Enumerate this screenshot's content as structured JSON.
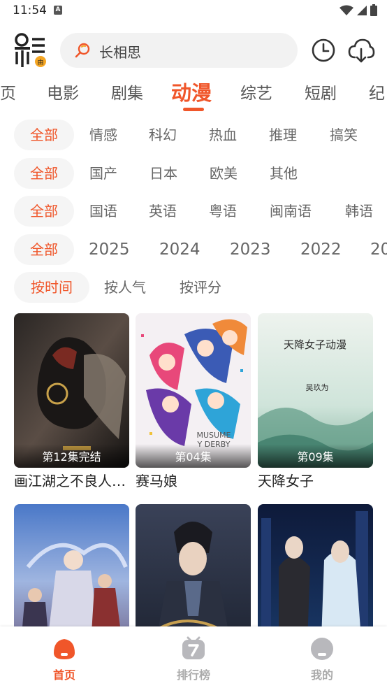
{
  "status_bar": {
    "time": "11:54",
    "notif_letter": "A"
  },
  "header": {
    "search_text": "长相思"
  },
  "category_tabs": [
    "页",
    "电影",
    "剧集",
    "动漫",
    "综艺",
    "短剧",
    "纪"
  ],
  "filters": {
    "genre": [
      "全部",
      "情感",
      "科幻",
      "热血",
      "推理",
      "搞笑"
    ],
    "region": [
      "全部",
      "国产",
      "日本",
      "欧美",
      "其他"
    ],
    "language": [
      "全部",
      "国语",
      "英语",
      "粤语",
      "闽南语",
      "韩语"
    ],
    "year": [
      "全部",
      "2025",
      "2024",
      "2023",
      "2022",
      "20"
    ],
    "sort": [
      "按时间",
      "按人气",
      "按评分"
    ]
  },
  "cards": [
    {
      "title": "画江湖之不良人 第七季",
      "badge": "第12集完结"
    },
    {
      "title": "赛马娘",
      "badge": "第04集"
    },
    {
      "title": "天降女子",
      "badge": "第09集"
    },
    {
      "title": "",
      "badge": ""
    },
    {
      "title": "",
      "badge": ""
    },
    {
      "title": "",
      "badge": ""
    }
  ],
  "poster_texts": {
    "card2": "MUSUME\nY DERBY",
    "card3_main": "天降女子动漫",
    "card3_sub": "吴玖为"
  },
  "bottom_nav": [
    {
      "label": "首页"
    },
    {
      "label": "排行榜"
    },
    {
      "label": "我的"
    }
  ],
  "colors": {
    "accent": "#f0562a",
    "chip_bg": "#f5f5f5",
    "search_bg": "#f2f2f2"
  }
}
